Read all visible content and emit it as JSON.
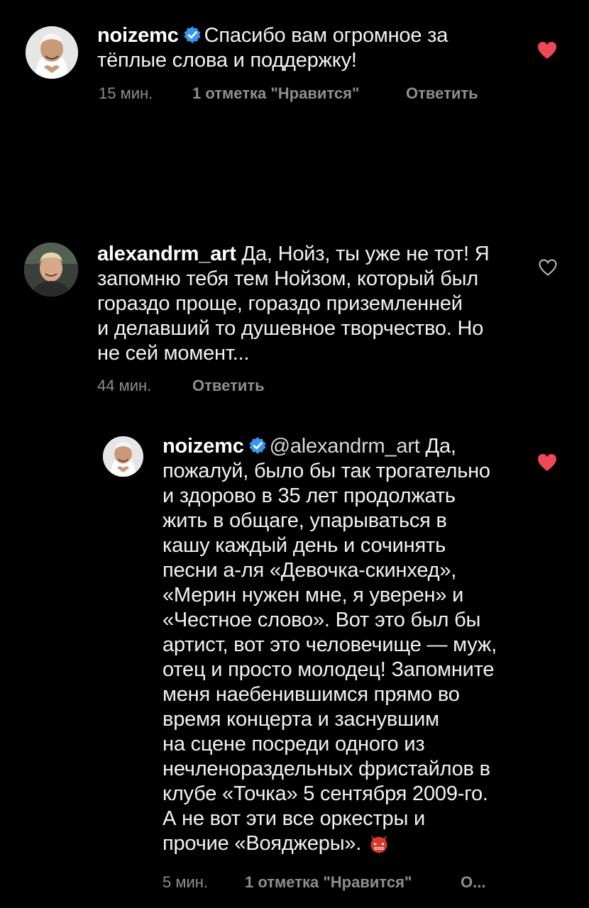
{
  "comments": [
    {
      "username": "noizemc",
      "verified": true,
      "lines": [
        "Спасибо вам огромное за",
        "тёплые слова и поддержку!"
      ],
      "time": "15 мин.",
      "likes": "1 отметка \"Нравится\"",
      "reply": "Ответить",
      "liked": true
    },
    {
      "username": "alexandrm_art",
      "verified": false,
      "lines": [
        "Да, Нойз, ты уже не тот! Я",
        "запомню тебя тем Нойзом, который был",
        "гораздо проще, гораздо приземленней",
        "и делавший то душевное творчество. Но",
        "не сей момент..."
      ],
      "time": "44 мин.",
      "reply": "Ответить",
      "liked": false
    },
    {
      "username": "noizemc",
      "verified": true,
      "mention": "@alexandrm_art",
      "first_line_rest": "Да,",
      "lines": [
        "пожалуй, было бы так трогательно",
        "и здорово в 35 лет продолжать",
        "жить в общаге, упарываться в",
        "кашу каждый день и сочинять",
        "песни а-ля «Девочка-скинхед»,",
        "«Мерин нужен мне, я уверен» и",
        "«Честное слово». Вот это был бы",
        "артист, вот это человечище — муж,",
        "отец и просто молодец! Запомните",
        "меня наебенившимся прямо во",
        "время концерта и заснувшим",
        "на сцене посреди одного из",
        "нечленораздельных фристайлов в",
        "клубе «Точка» 5 сентября 2009-го.",
        "А не вот эти все оркестры и",
        "прочие «Вояджеры»."
      ],
      "emoji": "devil-emoji",
      "time": "5 мин.",
      "likes": "1 отметка \"Нравится\"",
      "reply": "О...",
      "liked": true
    }
  ],
  "colors": {
    "background": "#000000",
    "text": "#f2f2f2",
    "meta": "#8e8e8e",
    "heart": "#ed4956",
    "verified": "#3797f0"
  },
  "icons": {
    "verified": "verified-badge-icon",
    "heart_filled": "heart-filled-icon",
    "heart_outline": "heart-outline-icon"
  }
}
